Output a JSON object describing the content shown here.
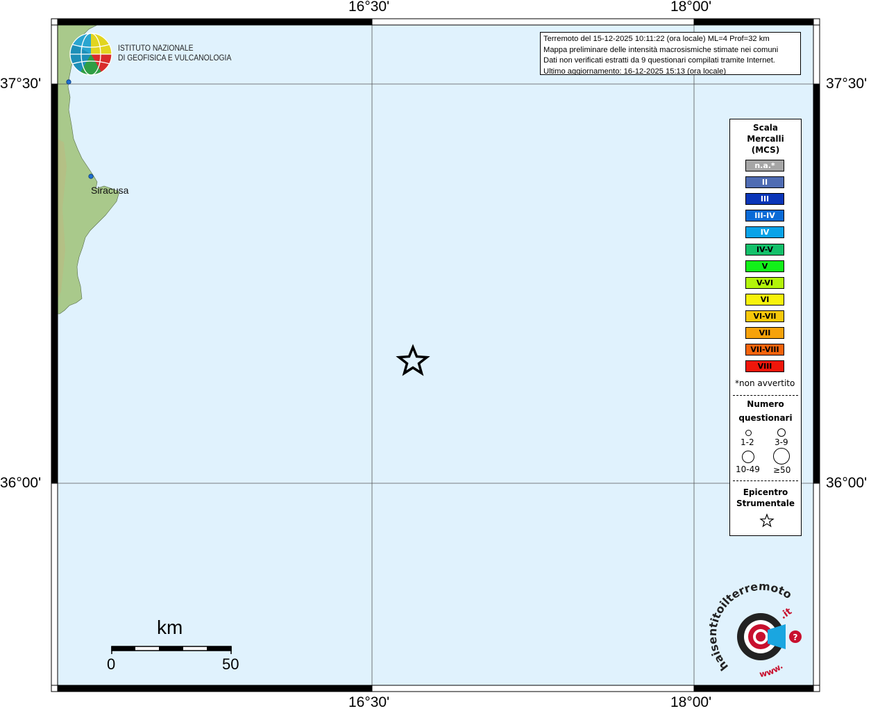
{
  "map": {
    "title": "Terremoto del 15-12-2025 10:11:22 (ora locale) ML=4 Prof=32 km",
    "lines": [
      "Terremoto del 15-12-2025 10:11:22 (ora locale) ML=4 Prof=32 km",
      "Mappa preliminare delle intensità macrosismiche stimate nei comuni",
      "Dati non verificati estratti da 9 questionari compilati tramite Internet.",
      "Ultimo aggiornamento: 16-12-2025 15:13 (ora locale)"
    ],
    "lon_labels": [
      "16°30'",
      "18°00'"
    ],
    "lat_labels": [
      "37°30'",
      "36°00'"
    ],
    "city": "Siracusa",
    "institute": [
      "ISTITUTO NAZIONALE",
      "DI GEOFISICA E VULCANOLOGIA"
    ],
    "scale": {
      "title": "km",
      "min": "0",
      "max": "50"
    },
    "colors": {
      "sea": "#e0f2fd",
      "land": "#a9c98b",
      "frame": "#000000"
    }
  },
  "legend": {
    "title": [
      "Scala",
      "Mercalli",
      "(MCS)"
    ],
    "intensities": [
      {
        "label": "n.a.*",
        "color": "#a6a6a6",
        "text_color": "#ffffff"
      },
      {
        "label": "II",
        "color": "#4f6cb3",
        "text_color": "#ffffff"
      },
      {
        "label": "III",
        "color": "#0a35b8",
        "text_color": "#ffffff"
      },
      {
        "label": "III-IV",
        "color": "#0a6ad6",
        "text_color": "#ffffff"
      },
      {
        "label": "IV",
        "color": "#0aa3e8",
        "text_color": "#ffffff"
      },
      {
        "label": "IV-V",
        "color": "#13c06a",
        "text_color": "#000000"
      },
      {
        "label": "V",
        "color": "#12f019",
        "text_color": "#000000"
      },
      {
        "label": "V-VI",
        "color": "#b3f40a",
        "text_color": "#000000"
      },
      {
        "label": "VI",
        "color": "#f7f20a",
        "text_color": "#000000"
      },
      {
        "label": "VI-VII",
        "color": "#f6c80a",
        "text_color": "#000000"
      },
      {
        "label": "VII",
        "color": "#f6a20a",
        "text_color": "#000000"
      },
      {
        "label": "VII-VIII",
        "color": "#f4630a",
        "text_color": "#000000"
      },
      {
        "label": "VIII",
        "color": "#f0160a",
        "text_color": "#000000"
      }
    ],
    "note": "*non avvertito",
    "questionnaires_title": [
      "Numero",
      "questionari"
    ],
    "questionnaire_sizes": [
      "1-2",
      "3-9",
      "10-49",
      "≥50"
    ],
    "epicenter_title": [
      "Epicentro",
      "Strumentale"
    ]
  },
  "logo": {
    "brand": "haisentitoilterremoto",
    "tld": ".it",
    "prefix": "www."
  }
}
